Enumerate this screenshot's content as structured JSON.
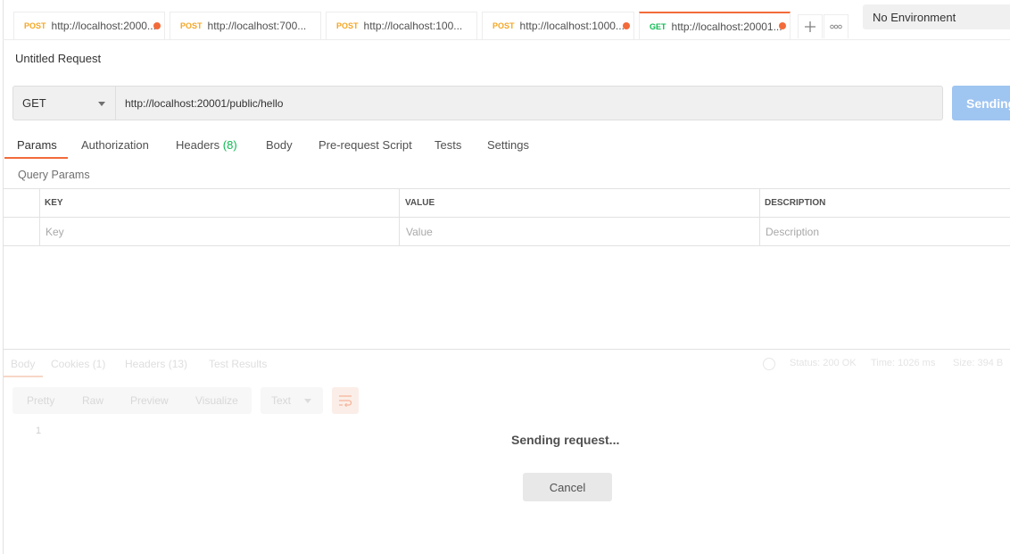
{
  "tabs": [
    {
      "method": "POST",
      "url": "http://localhost:2000...",
      "unsaved": true
    },
    {
      "method": "POST",
      "url": "http://localhost:700...",
      "unsaved": false
    },
    {
      "method": "POST",
      "url": "http://localhost:100...",
      "unsaved": false
    },
    {
      "method": "POST",
      "url": "http://localhost:1000...",
      "unsaved": true
    },
    {
      "method": "GET",
      "url": "http://localhost:20001...",
      "unsaved": true,
      "active": true
    }
  ],
  "tab_actions": {
    "add_icon": "plus-icon",
    "more_icon": "more-icon"
  },
  "environment": {
    "selected": "No Environment"
  },
  "request": {
    "title": "Untitled Request",
    "method": "GET",
    "url": "http://localhost:20001/public/hello",
    "send_label": "Sending"
  },
  "request_tabs": [
    {
      "label": "Params"
    },
    {
      "label": "Authorization"
    },
    {
      "label": "Headers",
      "count": "(8)"
    },
    {
      "label": "Body"
    },
    {
      "label": "Pre-request Script"
    },
    {
      "label": "Tests"
    },
    {
      "label": "Settings"
    }
  ],
  "query_params": {
    "title": "Query Params",
    "columns": [
      "KEY",
      "VALUE",
      "DESCRIPTION"
    ],
    "placeholders": [
      "Key",
      "Value",
      "Description"
    ]
  },
  "response": {
    "tabs": [
      "Body",
      "Cookies (1)",
      "Headers (13)",
      "Test Results"
    ],
    "status": "Status: 200 OK",
    "time": "Time: 1026 ms",
    "size": "Size: 394 B",
    "formats": [
      "Pretty",
      "Raw",
      "Preview",
      "Visualize"
    ],
    "type": "Text",
    "line_number": "1"
  },
  "overlay": {
    "message": "Sending request...",
    "cancel_label": "Cancel"
  },
  "colors": {
    "accent": "#f26b3a",
    "post": "#f5a623",
    "get": "#0cbb52",
    "send": "#9fc5f1"
  }
}
